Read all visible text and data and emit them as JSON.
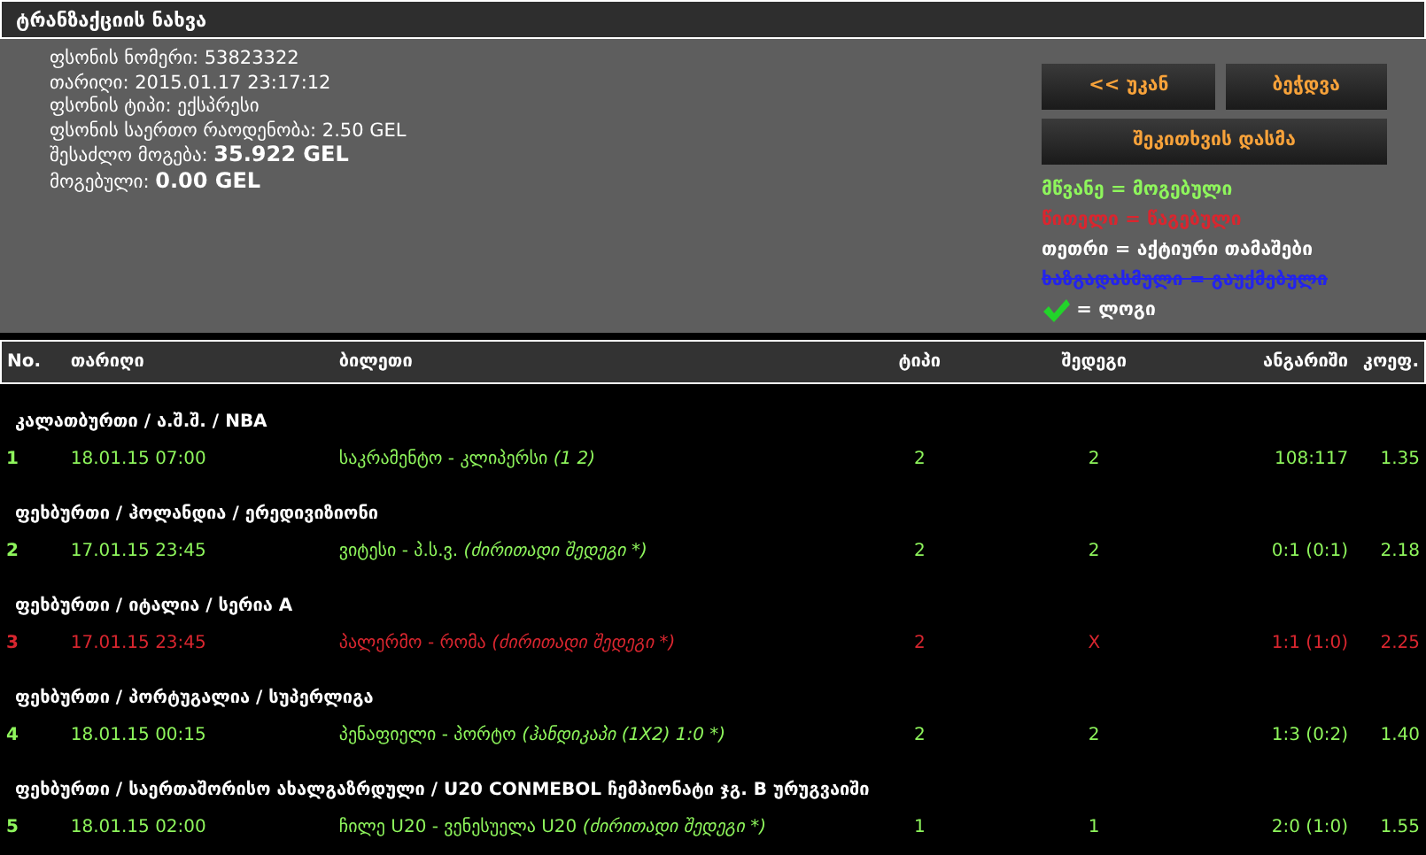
{
  "window": {
    "title": "ტრანზაქციის ნახვა"
  },
  "info": [
    {
      "label": "ფსონის ნომერი:",
      "value": "53823322",
      "bold": false
    },
    {
      "label": "თარიღი:",
      "value": "2015.01.17 23:17:12",
      "bold": false
    },
    {
      "label": "ფსონის ტიპი:",
      "value": "ექსპრესი",
      "bold": false
    },
    {
      "label": "ფსონის საერთო რაოდენობა:",
      "value": "2.50 GEL",
      "bold": false
    },
    {
      "label": "შესაძლო მოგება:",
      "value": "35.922 GEL",
      "bold": true
    },
    {
      "label": "მოგებული:",
      "value": "0.00 GEL",
      "bold": true
    }
  ],
  "buttons": [
    {
      "label": "<< უკან"
    },
    {
      "label": "ბეჭდვა"
    },
    {
      "label": "შეკითხვის დასმა"
    }
  ],
  "legend": [
    {
      "kind": "won",
      "term": "მწვანე",
      "meaning": "= მოგებული"
    },
    {
      "kind": "lost",
      "term": "წითელი",
      "meaning": "= წაგებული"
    },
    {
      "kind": "active",
      "term": "თეთრი",
      "meaning": "= აქტიური თამაშები"
    },
    {
      "kind": "cancelled",
      "term": "ხაზგადასმული",
      "meaning": "= გაუქმებული"
    },
    {
      "kind": "check",
      "meaning": "= ლოგი"
    }
  ],
  "table": {
    "columns": [
      "No.",
      "თარიღი",
      "ბილეთი",
      "ტიპი",
      "შედეგი",
      "ანგარიში",
      "კოეფ."
    ],
    "groups": [
      {
        "title": "კალათბურთი / ა.შ.შ. / NBA",
        "rows": [
          {
            "kind": "won",
            "no": "1",
            "date": "18.01.15 07:00",
            "event": "საკრამენტო - კლიპერსი",
            "market": "(1 2)",
            "type": "2",
            "result": "2",
            "score": "108:117",
            "odds": "1.35"
          }
        ]
      },
      {
        "title": "ფეხბურთი / ჰოლანდია / ერედივიზიონი",
        "rows": [
          {
            "kind": "won",
            "no": "2",
            "date": "17.01.15 23:45",
            "event": "ვიტესი - პ.ს.ვ.",
            "market": "(ძირითადი შედეგი *)",
            "type": "2",
            "result": "2",
            "score": "0:1 (0:1)",
            "odds": "2.18"
          }
        ]
      },
      {
        "title": "ფეხბურთი / იტალია / სერია A",
        "rows": [
          {
            "kind": "lost",
            "no": "3",
            "date": "17.01.15 23:45",
            "event": "პალერმო - რომა",
            "market": "(ძირითადი შედეგი *)",
            "type": "2",
            "result": "X",
            "score": "1:1 (1:0)",
            "odds": "2.25"
          }
        ]
      },
      {
        "title": "ფეხბურთი / პორტუგალია / სუპერლიგა",
        "rows": [
          {
            "kind": "won",
            "no": "4",
            "date": "18.01.15 00:15",
            "event": "პენაფიელი - პორტო",
            "market": "(ჰანდიკაპი (1X2) 1:0 *)",
            "type": "2",
            "result": "2",
            "score": "1:3 (0:2)",
            "odds": "1.40"
          }
        ]
      },
      {
        "title": "ფეხბურთი / საერთაშორისო ახალგაზრდული / U20 CONMEBOL ჩემპიონატი ჯგ. B ურუგვაიში",
        "rows": [
          {
            "kind": "won",
            "no": "5",
            "date": "18.01.15 02:00",
            "event": "ჩილე U20 - ვენესუელა U20",
            "market": "(ძირითადი შედეგი *)",
            "type": "1",
            "result": "1",
            "score": "2:0 (1:0)",
            "odds": "1.55"
          }
        ]
      }
    ]
  }
}
